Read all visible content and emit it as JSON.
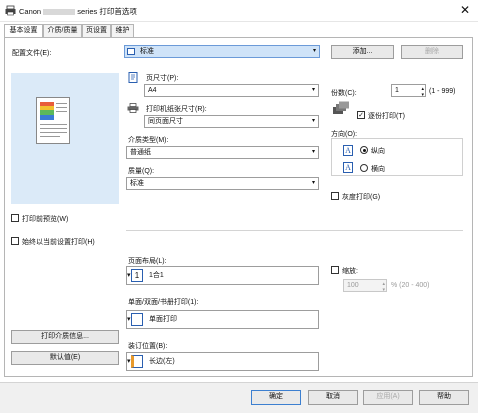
{
  "window": {
    "title_prefix": "Canon",
    "title_suffix": "series 打印首选项"
  },
  "tabs": [
    {
      "label": "基本设置"
    },
    {
      "label": "介质/质量"
    },
    {
      "label": "页设置"
    },
    {
      "label": "维护"
    }
  ],
  "profile": {
    "label": "配置文件(E):",
    "value": "标准",
    "add": "添加...",
    "delete": "删除"
  },
  "page_size": {
    "label": "页尺寸(P):",
    "value": "A4"
  },
  "printer_paper_size": {
    "label": "打印机纸张尺寸(R):",
    "value": "同页面尺寸"
  },
  "media_type": {
    "label": "介质类型(M):",
    "value": "普通纸"
  },
  "quality": {
    "label": "质量(Q):",
    "value": "标准"
  },
  "copies": {
    "label": "份数(C):",
    "value": "1",
    "range": "(1 - 999)"
  },
  "collate": {
    "label": "逐份打印(T)",
    "checked": true
  },
  "orientation": {
    "label": "方向(O):",
    "portrait": "纵向",
    "landscape": "横向",
    "selected": "portrait"
  },
  "grayscale": {
    "label": "灰度打印(G)",
    "checked": false
  },
  "preview_before": {
    "label": "打印前预览(W)",
    "checked": false
  },
  "always_current": {
    "label": "始终以当前设置打印(H)",
    "checked": false
  },
  "layout": {
    "label": "页面布局(L):",
    "value": "1合1",
    "icon_num": "1"
  },
  "duplex": {
    "label": "单面/双面/书册打印(1):",
    "value": "单面打印"
  },
  "binding": {
    "label": "装订位置(B):",
    "value": "长边(左)"
  },
  "scale": {
    "label": "缩放:",
    "value": "100",
    "range": "% (20 - 400)",
    "checked": false
  },
  "buttons": {
    "media_info": "打印介质信息...",
    "defaults": "默认值(E)",
    "ok": "确定",
    "cancel": "取消",
    "apply": "应用(A)",
    "help": "帮助"
  },
  "icons": {
    "close": "✕",
    "down_arrow": "▾",
    "spin_up": "▴",
    "spin_down": "▾"
  },
  "colors": {
    "accent": "#2a5fb0",
    "selected_bg": "#cfe3f8"
  }
}
